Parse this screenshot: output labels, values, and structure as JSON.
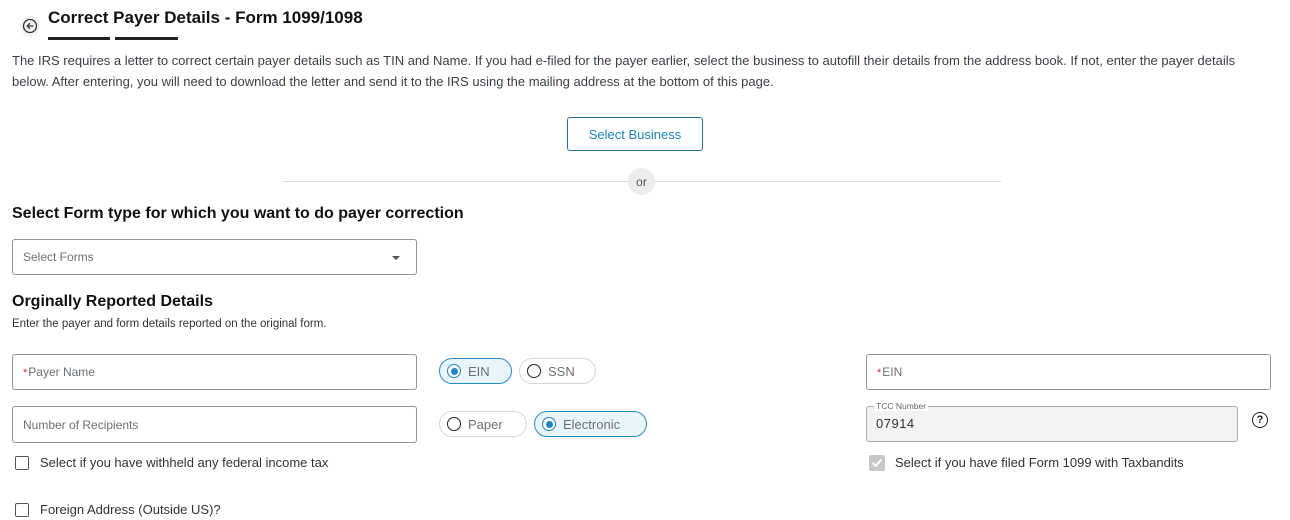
{
  "header": {
    "title": "Correct Payer Details - Form 1099/1098",
    "back_icon": "arrow-left-circle-icon"
  },
  "intro": {
    "text": "The IRS requires a letter to correct certain payer details such as TIN and Name. If you had e-filed for the payer earlier, select the business to autofill their details from the address book. If not, enter the payer details below. After entering, you will need to download the letter and send it to the IRS using the mailing address at the bottom of this page."
  },
  "select_business": {
    "button_label": "Select Business",
    "or_label": "or"
  },
  "form_type": {
    "heading": "Select Form type for which you want to do payer correction",
    "select_placeholder": "Select Forms"
  },
  "original_details": {
    "heading": "Orginally Reported Details",
    "subheading": "Enter the payer and form details reported on the original form.",
    "payer_name_placeholder": "Payer Name",
    "tin_type_options": [
      {
        "label": "EIN",
        "selected": true
      },
      {
        "label": "SSN",
        "selected": false
      }
    ],
    "ein_placeholder": "EIN",
    "required_marker": "*",
    "recipients_placeholder": "Number of Recipients",
    "filing_type_options": [
      {
        "label": "Paper",
        "selected": false
      },
      {
        "label": "Electronic",
        "selected": true
      }
    ],
    "tcc": {
      "label": "TCC Number",
      "value": "07914",
      "help_icon": "question-circle-icon",
      "help_glyph": "?"
    },
    "withheld_checkbox": {
      "label": "Select if you have withheld any federal income tax",
      "checked": false
    },
    "taxbandits_checkbox": {
      "label": "Select if you have filed Form 1099 with Taxbandits",
      "checked": true,
      "disabled": true
    },
    "foreign_address_checkbox": {
      "label": "Foreign Address (Outside US)?",
      "checked": false
    }
  },
  "colors": {
    "accent": "#1d84b5",
    "selected_pill_bg": "#eaf4fb",
    "required": "#d0312d"
  }
}
